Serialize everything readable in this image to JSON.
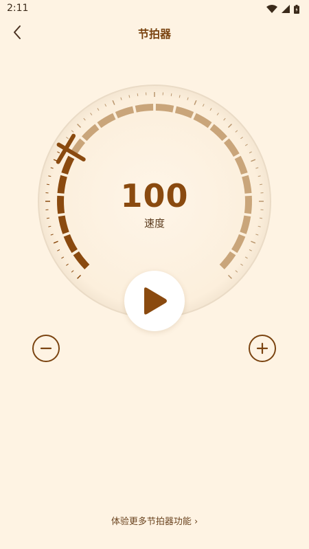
{
  "status": {
    "time": "2:11"
  },
  "header": {
    "title": "节拍器"
  },
  "tempo": {
    "value": "100",
    "label": "速度",
    "level": 0.28
  },
  "footer": {
    "more_link": "体验更多节拍器功能 ›"
  },
  "icons": {
    "back": "chevron-left-icon",
    "play": "play-icon",
    "minus": "minus-icon",
    "plus": "plus-icon",
    "wifi": "wifi-icon",
    "signal": "signal-icon",
    "battery": "battery-icon"
  },
  "colors": {
    "background": "#FEF3E3",
    "accent": "#8A4A0F",
    "arc_inactive": "#C9A57A"
  }
}
